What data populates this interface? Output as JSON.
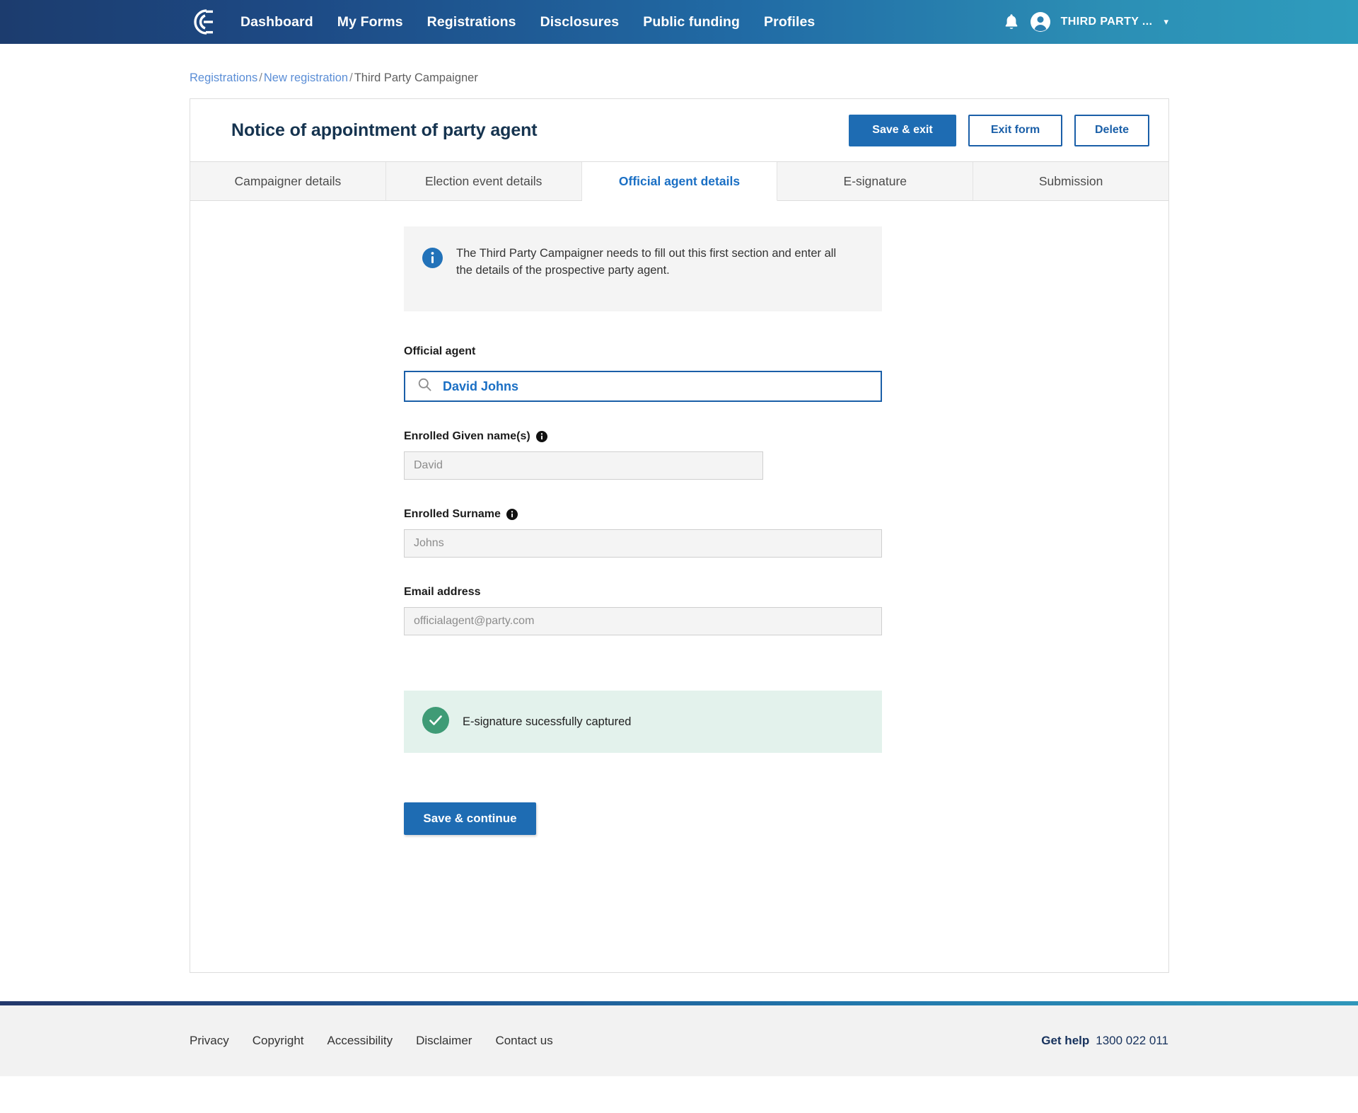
{
  "nav": {
    "logo_icon": "nswec-e-logo-icon",
    "links": [
      {
        "label": "Dashboard"
      },
      {
        "label": "My Forms"
      },
      {
        "label": "Registrations"
      },
      {
        "label": "Disclosures"
      },
      {
        "label": "Public funding"
      },
      {
        "label": "Profiles"
      }
    ],
    "notifications_icon": "bell-icon",
    "avatar_icon": "user-avatar-icon",
    "user_label": "THIRD PARTY ...",
    "caret": "▾"
  },
  "breadcrumb": {
    "items": [
      {
        "label": "Registrations",
        "link": true
      },
      {
        "label": "New registration",
        "link": true
      },
      {
        "label": "Third Party Campaigner",
        "link": false
      }
    ],
    "separator": "/"
  },
  "header": {
    "title": "Notice of appointment of party agent",
    "save_exit_label": "Save & exit",
    "exit_form_label": "Exit form",
    "delete_label": "Delete"
  },
  "tabs": [
    {
      "label": "Campaigner details",
      "active": false
    },
    {
      "label": "Election event details",
      "active": false
    },
    {
      "label": "Official agent details",
      "active": true
    },
    {
      "label": "E-signature",
      "active": false
    },
    {
      "label": "Submission",
      "active": false
    }
  ],
  "info_banner": {
    "icon": "info-circle-icon",
    "text": "The Third Party Campaigner needs to fill out this first section and enter all the details of the prospective party agent."
  },
  "form": {
    "official_agent": {
      "label": "Official agent",
      "search_icon": "search-icon",
      "value": "David Johns"
    },
    "given_names": {
      "label": "Enrolled Given name(s)",
      "info_icon": "info-circle-icon",
      "value": "David"
    },
    "surname": {
      "label": "Enrolled Surname",
      "info_icon": "info-circle-icon",
      "value": "Johns"
    },
    "email": {
      "label": "Email address",
      "value": "officialagent@party.com"
    },
    "esignature_status": {
      "icon": "check-circle-icon",
      "text": "E-signature sucessfully captured"
    },
    "save_continue_label": "Save & continue"
  },
  "footer": {
    "links": [
      {
        "label": "Privacy"
      },
      {
        "label": "Copyright"
      },
      {
        "label": "Accessibility"
      },
      {
        "label": "Disclaimer"
      },
      {
        "label": "Contact us"
      }
    ],
    "help_label": "Get help",
    "help_phone": "1300 022 011"
  },
  "colors": {
    "brand_navy": "#1c3c6e",
    "brand_teal": "#2e9cbd",
    "primary_blue": "#1e6cb3",
    "link_blue": "#1a6fc4",
    "success_green": "#3f9b76",
    "success_bg": "#e3f2ec",
    "info_bg": "#f4f4f4"
  }
}
